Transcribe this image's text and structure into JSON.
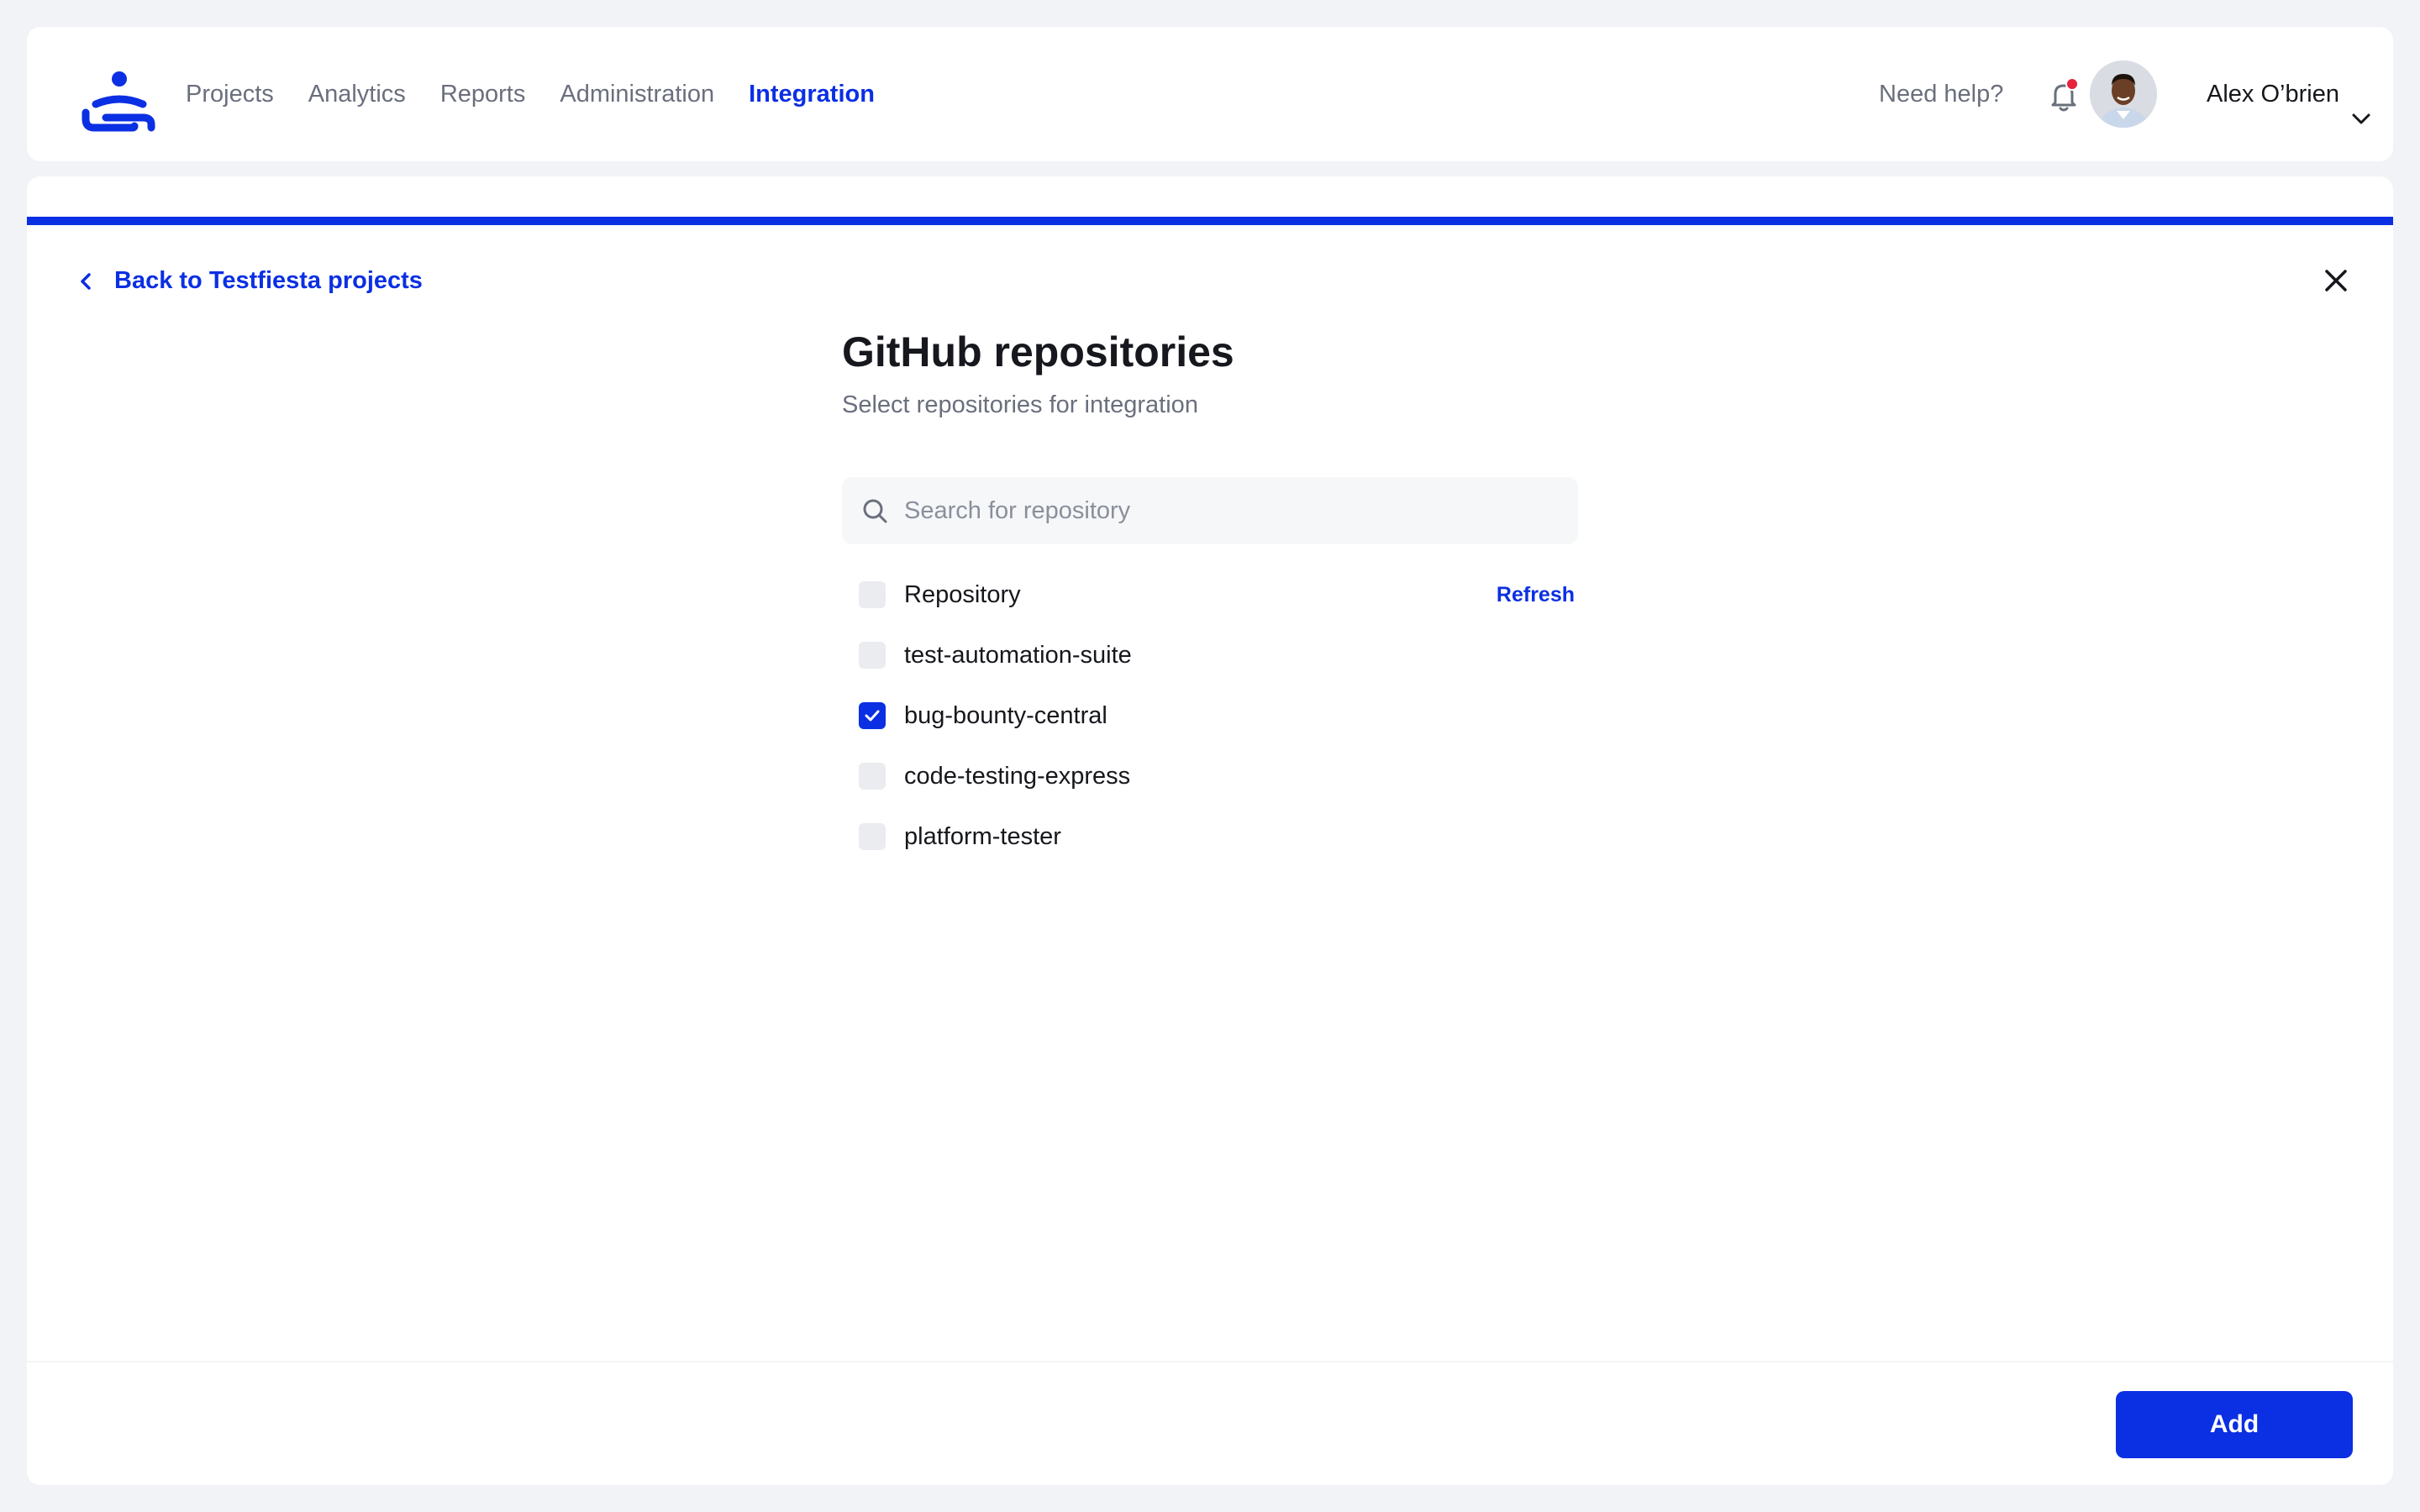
{
  "nav": {
    "items": [
      {
        "label": "Projects",
        "active": false
      },
      {
        "label": "Analytics",
        "active": false
      },
      {
        "label": "Reports",
        "active": false
      },
      {
        "label": "Administration",
        "active": false
      },
      {
        "label": "Integration",
        "active": true
      }
    ],
    "help_label": "Need help?",
    "notification_dot": true,
    "user_name": "Alex O’brien"
  },
  "wizard": {
    "progress_fraction": 1.0,
    "back_label": "Back to Testfiesta projects",
    "title": "GitHub repositories",
    "subtitle": "Select repositories for integration",
    "search_placeholder": "Search for repository",
    "search_value": "",
    "header_row": {
      "label": "Repository",
      "checked": false
    },
    "refresh_label": "Refresh",
    "repositories": [
      {
        "name": "test-automation-suite",
        "checked": false
      },
      {
        "name": "bug-bounty-central",
        "checked": true
      },
      {
        "name": "code-testing-express",
        "checked": false
      },
      {
        "name": "platform-tester",
        "checked": false
      }
    ],
    "add_label": "Add"
  },
  "colors": {
    "accent": "#0b2fe3",
    "notification": "#e5243b",
    "background": "#f2f3f6"
  },
  "icons": [
    "logo-icon",
    "bell-icon",
    "chevron-down-icon",
    "chevron-left-icon",
    "close-icon",
    "search-icon",
    "check-icon"
  ]
}
